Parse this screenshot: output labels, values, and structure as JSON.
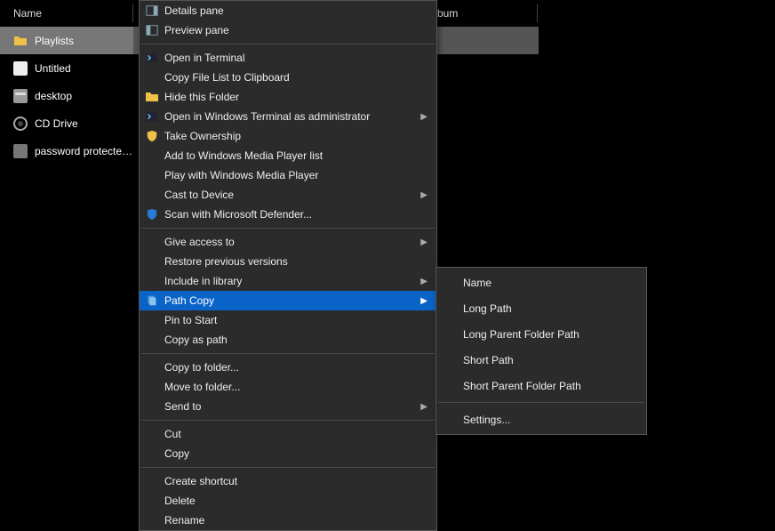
{
  "columns": {
    "name": "Name",
    "album_partial": "bum"
  },
  "sidebar": {
    "items": [
      {
        "label": "Playlists",
        "icon": "folder",
        "selected": true
      },
      {
        "label": "Untitled",
        "icon": "file"
      },
      {
        "label": "desktop",
        "icon": "drive"
      },
      {
        "label": "CD Drive",
        "icon": "disc"
      },
      {
        "label": "password protected...",
        "icon": "encrypted"
      }
    ]
  },
  "context_menu": {
    "groups": [
      [
        {
          "label": "Details pane",
          "icon": "layout"
        },
        {
          "label": "Preview pane",
          "icon": "preview"
        }
      ],
      [
        {
          "label": "Open in Terminal",
          "icon": "terminal"
        },
        {
          "label": "Copy File List to Clipboard"
        },
        {
          "label": "Hide this Folder",
          "icon": "folder"
        },
        {
          "label": "Open in Windows Terminal as administrator",
          "icon": "terminal",
          "submenu": true
        },
        {
          "label": "Take Ownership",
          "icon": "shield"
        },
        {
          "label": "Add to Windows Media Player list"
        },
        {
          "label": "Play with Windows Media Player"
        },
        {
          "label": "Cast to Device",
          "submenu": true
        },
        {
          "label": "Scan with Microsoft Defender...",
          "icon": "shield-blue"
        }
      ],
      [
        {
          "label": "Give access to",
          "submenu": true
        },
        {
          "label": "Restore previous versions"
        },
        {
          "label": "Include in library",
          "submenu": true
        },
        {
          "label": "Path Copy",
          "icon": "copy",
          "submenu": true,
          "highlighted": true
        },
        {
          "label": "Pin to Start"
        },
        {
          "label": "Copy as path"
        }
      ],
      [
        {
          "label": "Copy to folder..."
        },
        {
          "label": "Move to folder..."
        },
        {
          "label": "Send to",
          "submenu": true
        }
      ],
      [
        {
          "label": "Cut"
        },
        {
          "label": "Copy"
        }
      ],
      [
        {
          "label": "Create shortcut"
        },
        {
          "label": "Delete"
        },
        {
          "label": "Rename"
        }
      ]
    ]
  },
  "submenu": {
    "items": [
      {
        "label": "Name"
      },
      {
        "label": "Long Path"
      },
      {
        "label": "Long Parent Folder Path"
      },
      {
        "label": "Short Path"
      },
      {
        "label": "Short Parent Folder Path"
      }
    ],
    "footer": [
      {
        "label": "Settings..."
      }
    ]
  },
  "icons": {
    "folder_fill": "#f0c04a",
    "shield_fill": "#f0c04a",
    "shield_blue_fill": "#2a7bd8"
  }
}
